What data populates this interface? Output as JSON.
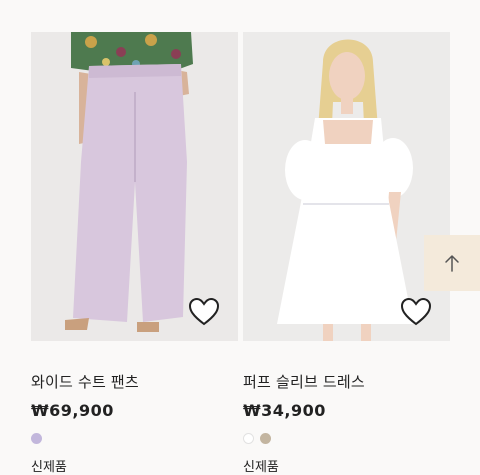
{
  "products": [
    {
      "name": "와이드 수트 팬츠",
      "price": "₩69,900",
      "badge": "신제품",
      "image_icon": "pants-photo",
      "swatches": [
        "#c2b7dc"
      ]
    },
    {
      "name": "퍼프 슬리브 드레스",
      "price": "₩34,900",
      "badge": "신제품",
      "image_icon": "dress-photo",
      "swatches": [
        "#ffffff",
        "#c3b5a0"
      ]
    }
  ],
  "scroll_top_icon": "arrow-up-icon",
  "colors": {
    "background": "#faf9f8",
    "image_bg": "#ecebea",
    "scroll_button_bg": "#f4eadb"
  }
}
